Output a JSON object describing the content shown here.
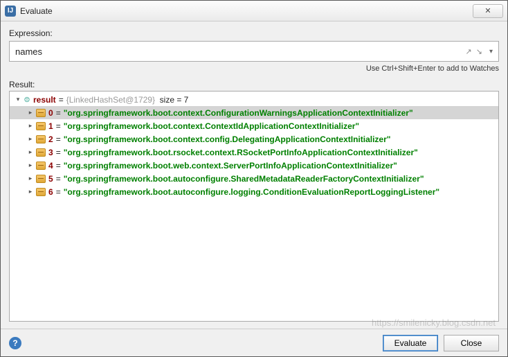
{
  "window": {
    "title": "Evaluate",
    "close": "✕"
  },
  "expression": {
    "label": "Expression:",
    "value": "names",
    "hint": "Use Ctrl+Shift+Enter to add to Watches"
  },
  "result": {
    "label": "Result:",
    "root_name": "result",
    "root_type": "{LinkedHashSet@1729}",
    "root_size_label": "size = 7",
    "items": [
      {
        "idx": "0",
        "value": "\"org.springframework.boot.context.ConfigurationWarningsApplicationContextInitializer\"",
        "selected": true
      },
      {
        "idx": "1",
        "value": "\"org.springframework.boot.context.ContextIdApplicationContextInitializer\"",
        "selected": false
      },
      {
        "idx": "2",
        "value": "\"org.springframework.boot.context.config.DelegatingApplicationContextInitializer\"",
        "selected": false
      },
      {
        "idx": "3",
        "value": "\"org.springframework.boot.rsocket.context.RSocketPortInfoApplicationContextInitializer\"",
        "selected": false
      },
      {
        "idx": "4",
        "value": "\"org.springframework.boot.web.context.ServerPortInfoApplicationContextInitializer\"",
        "selected": false
      },
      {
        "idx": "5",
        "value": "\"org.springframework.boot.autoconfigure.SharedMetadataReaderFactoryContextInitializer\"",
        "selected": false
      },
      {
        "idx": "6",
        "value": "\"org.springframework.boot.autoconfigure.logging.ConditionEvaluationReportLoggingListener\"",
        "selected": false
      }
    ]
  },
  "footer": {
    "help": "?",
    "evaluate": "Evaluate",
    "close": "Close"
  },
  "watermark": "https://smilenicky.blog.csdn.net"
}
